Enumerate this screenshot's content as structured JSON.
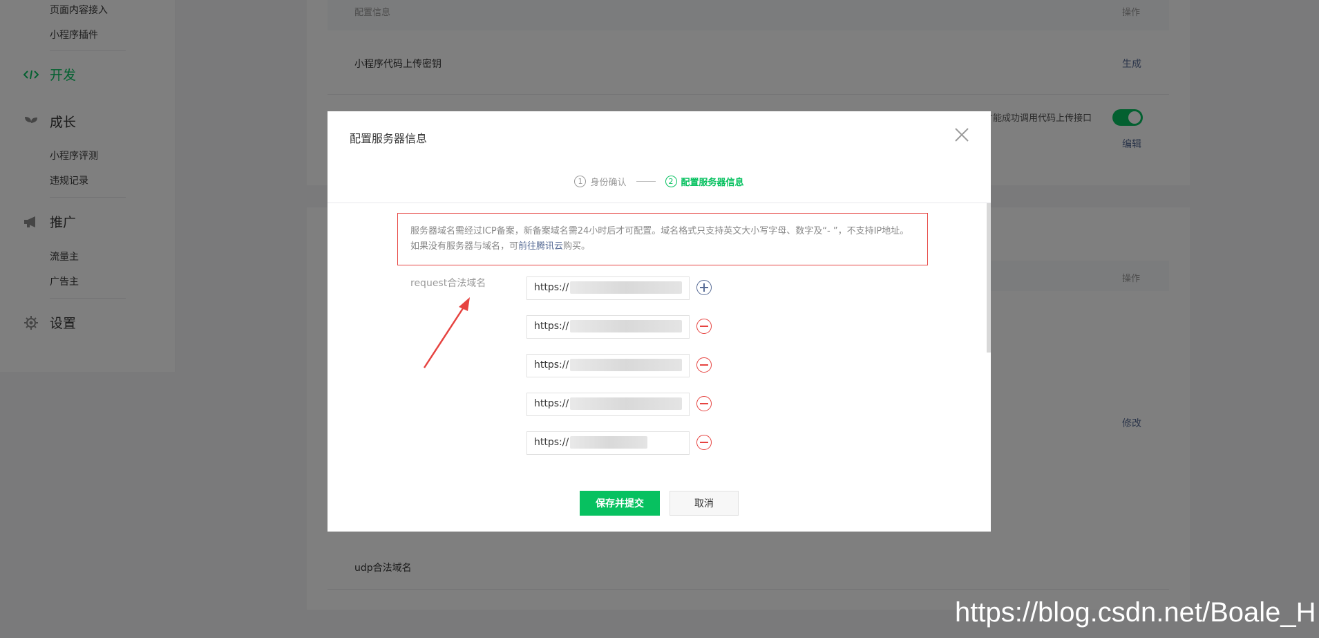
{
  "sidebar": {
    "sub_items_top": [
      "页面内容接入",
      "小程序插件"
    ],
    "dev_label": "开发",
    "growth_label": "成长",
    "growth_items": [
      "小程序评测",
      "违规记录"
    ],
    "promo_label": "推广",
    "promo_items": [
      "流量主",
      "广告主"
    ],
    "settings_label": "设置"
  },
  "background": {
    "config_header": "配置信息",
    "op_header": "操作",
    "upload_key_label": "小程序代码上传密钥",
    "generate_link": "生成",
    "ip_note": "才能成功调用代码上传接口",
    "edit_link": "编辑",
    "op_header2": "操作",
    "modify_link": "修改",
    "udp_label": "udp合法域名"
  },
  "dialog": {
    "title": "配置服务器信息",
    "steps": [
      {
        "num": "1",
        "label": "身份确认"
      },
      {
        "num": "2",
        "label": "配置服务器信息"
      }
    ],
    "notice_text": "服务器域名需经过ICP备案，新备案域名需24小时后才可配置。域名格式只支持英文大小写字母、数字及“- ”，不支持IP地址。如果没有服务器与域名，可",
    "notice_link": "前往腾讯云",
    "notice_suffix": "购买。",
    "request_label": "request合法域名",
    "domains": [
      "https://",
      "https://",
      "https://",
      "https://",
      "https://"
    ],
    "save_label": "保存并提交",
    "cancel_label": "取消"
  },
  "watermark": "https://blog.csdn.net/Boale_H",
  "colors": {
    "accent": "#07c160",
    "link": "#576b95",
    "danger": "#e64340"
  }
}
